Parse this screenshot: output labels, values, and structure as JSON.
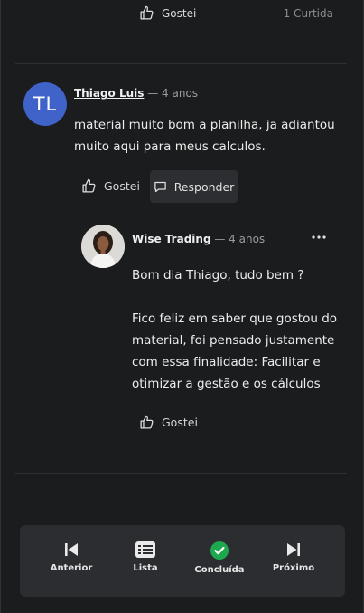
{
  "top": {
    "like_label": "Gostei",
    "like_count": "1 Curtida"
  },
  "comment": {
    "avatar_initials": "TL",
    "author": "Thiago Luis",
    "time": "— 4 anos",
    "text": [
      "material muito bom a planilha, ja adiantou",
      "muito aqui para meus calculos."
    ],
    "like_label": "Gostei",
    "reply_label": "Responder"
  },
  "reply": {
    "author": "Wise Trading",
    "time": "— 4 anos",
    "greeting": "Bom dia Thiago, tudo bem ?",
    "text": [
      "Fico feliz em saber que gostou do",
      "material, foi pensado justamente",
      "com essa finalidade: Facilitar  e",
      "otimizar a gestão e os cálculos"
    ],
    "like_label": "Gostei"
  },
  "nav": {
    "prev": "Anterior",
    "list": "Lista",
    "done": "Concluída",
    "next": "Próximo"
  },
  "colors": {
    "background": "#1b1c1e",
    "avatar_blue": "#3f63c9",
    "nav_bg": "#2b2d30",
    "done_green": "#1fa84f"
  },
  "icons": [
    "thumbs-up-icon",
    "speech-bubble-icon",
    "more-dots-icon",
    "skip-previous-icon",
    "list-icon",
    "check-circle-icon",
    "skip-next-icon"
  ]
}
